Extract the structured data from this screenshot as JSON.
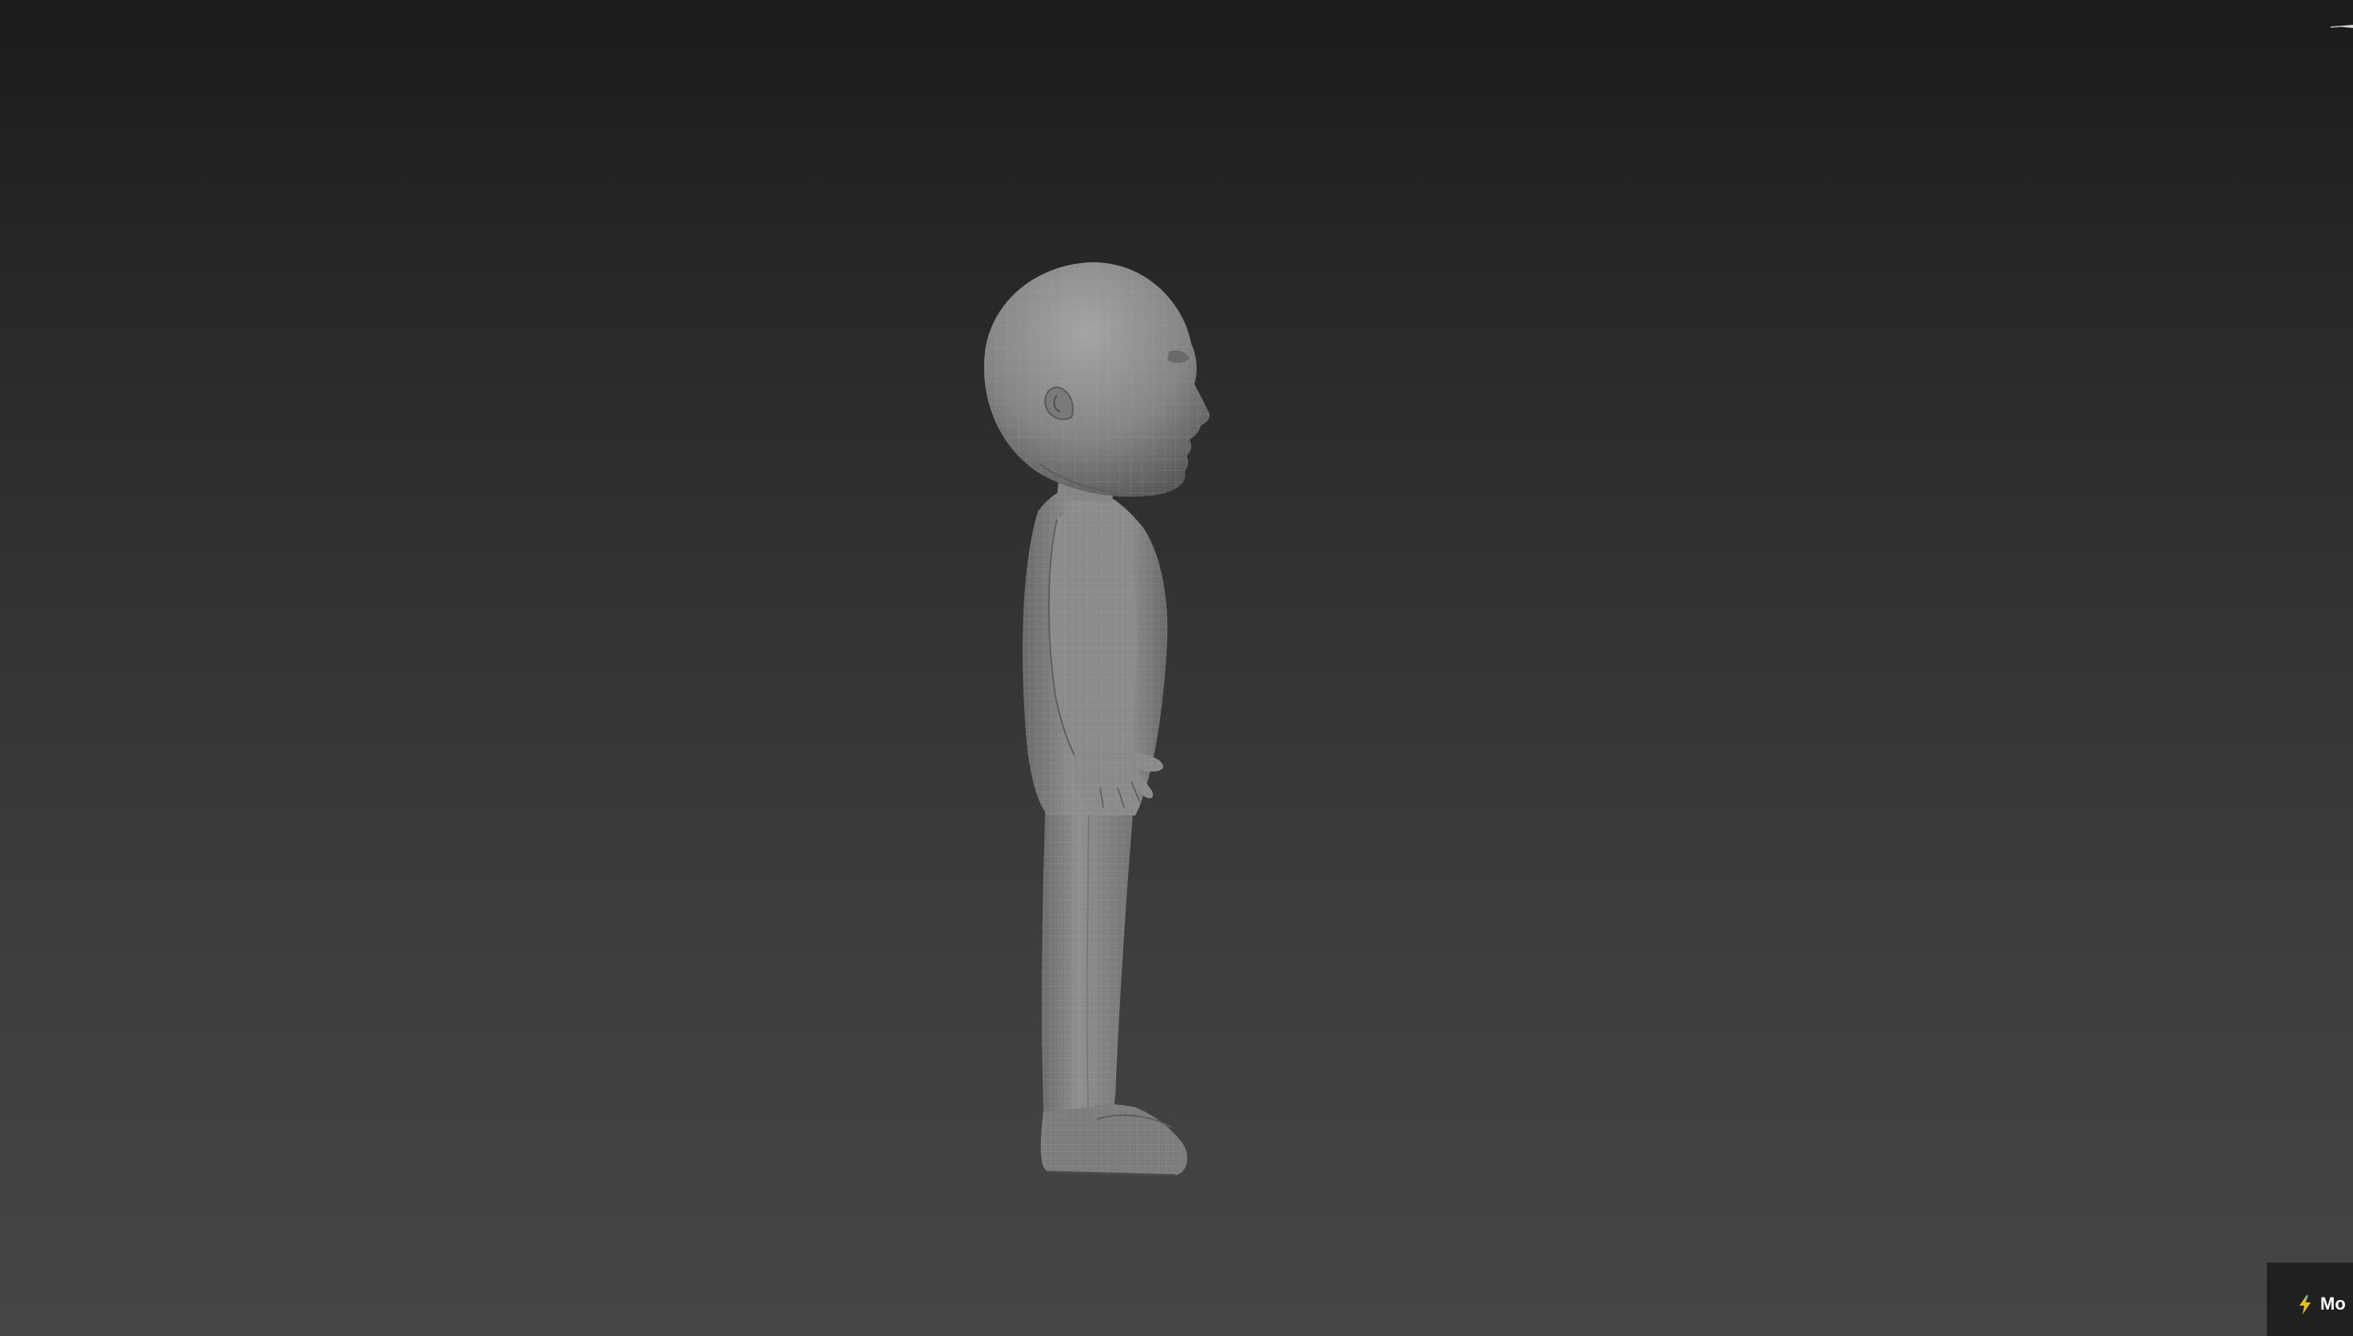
{
  "viewport": {
    "view": "side",
    "shading": "smooth-with-wireframe",
    "background_top": "#1b1b1b",
    "background_bottom": "#464646"
  },
  "model": {
    "subject": "child-character-mesh",
    "mesh_color": "#8a8a8a",
    "wire_color": "#a9a9a9"
  },
  "gizmo": {
    "icon": "view-cube-axis-icon"
  },
  "status": {
    "icon": "lightning-bolt-icon",
    "icon_color": "#f2c200",
    "label": "Mo"
  }
}
